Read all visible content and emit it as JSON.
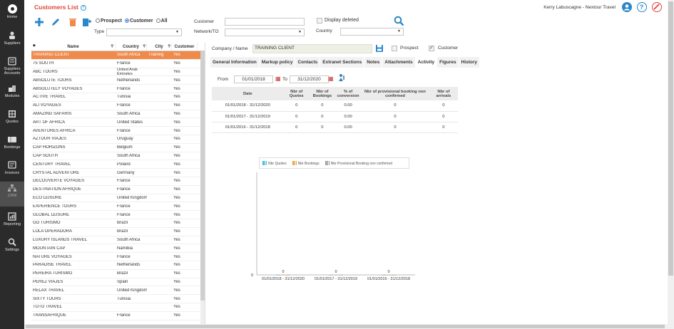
{
  "sidebar": [
    {
      "label": "Home",
      "icon": "home-icon"
    },
    {
      "label": "Suppliers",
      "icon": "suppliers-icon"
    },
    {
      "label": "Suppliers Accounts",
      "icon": "supplier-accounts-icon"
    },
    {
      "label": "Modules",
      "icon": "modules-icon"
    },
    {
      "label": "Quotes",
      "icon": "quotes-icon"
    },
    {
      "label": "Bookings",
      "icon": "bookings-icon"
    },
    {
      "label": "Invoices",
      "icon": "invoices-icon"
    },
    {
      "label": "CRM",
      "icon": "crm-icon"
    },
    {
      "label": "Reporting",
      "icon": "reporting-icon"
    },
    {
      "label": "Settings",
      "icon": "settings-icon"
    }
  ],
  "header": {
    "title": "Customers List",
    "help": "?",
    "user": "Kerry Labuscagne - Nextour Travel"
  },
  "filters": {
    "radio": [
      "Prospect",
      "Customer",
      "All"
    ],
    "type_label": "Type",
    "customer_label": "Customer",
    "network_label": "Network/TO",
    "display_deleted": "Display deleted",
    "country_label": "Country"
  },
  "table": {
    "headers": [
      "Name",
      "Country",
      "City",
      "Customer"
    ],
    "rows": [
      [
        "TRAINING CLIENT",
        "South Africa",
        "Training",
        "Yes"
      ],
      [
        "75 SOUTH",
        "France",
        "",
        "Yes"
      ],
      [
        "ABC TOURS",
        "United Arab Emirates",
        "",
        "Yes"
      ],
      [
        "ABSOLUTE TOURS",
        "Netherlands",
        "",
        "Yes"
      ],
      [
        "ABSOLUTELY VOYAGES",
        "France",
        "",
        "Yes"
      ],
      [
        "ACTIVE TRAVEL",
        "Tunisia",
        "",
        "Yes"
      ],
      [
        "ALI VOYAGES",
        "France",
        "",
        "Yes"
      ],
      [
        "AMAZING SAFARIS",
        "South Africa",
        "",
        "Yes"
      ],
      [
        "ART OF AFRICA",
        "United States",
        "",
        "Yes"
      ],
      [
        "AVENTURES AFRICA",
        "France",
        "",
        "Yes"
      ],
      [
        "AZTOUR VIAJES",
        "Uruguay",
        "",
        "Yes"
      ],
      [
        "CAP HORIZONS",
        "Belgium",
        "",
        "Yes"
      ],
      [
        "CAP SOUTH",
        "South Africa",
        "",
        "Yes"
      ],
      [
        "CENTURY TRAVEL",
        "Poland",
        "",
        "Yes"
      ],
      [
        "CRYSTAL ADVENTURE",
        "Germany",
        "",
        "Yes"
      ],
      [
        "DECOUVERTE VOYAGES",
        "France",
        "",
        "Yes"
      ],
      [
        "DESTINATION AFRIQUE",
        "France",
        "",
        "Yes"
      ],
      [
        "ECO LEISURE",
        "United Kingdom",
        "",
        "Yes"
      ],
      [
        "EXPERIENCE TOURS",
        "France",
        "",
        "Yes"
      ],
      [
        "GLOBAL LEISURE",
        "France",
        "",
        "Yes"
      ],
      [
        "GO TURISMO",
        "Brazil",
        "",
        "Yes"
      ],
      [
        "LOLA OPERADORA",
        "Brazil",
        "",
        "Yes"
      ],
      [
        "LUXURY ISLANDS TRAVEL",
        "South Africa",
        "",
        "Yes"
      ],
      [
        "MOUNTAIN CAP",
        "Namibia",
        "",
        "Yes"
      ],
      [
        "NATURE VOYAGES",
        "France",
        "",
        "Yes"
      ],
      [
        "PARADISE TRAVEL",
        "Netherlands",
        "",
        "Yes"
      ],
      [
        "PEREIRA TURISMO",
        "Brazil",
        "",
        "Yes"
      ],
      [
        "PEREZ VIAJES",
        "Spain",
        "",
        "Yes"
      ],
      [
        "RELAX TRAVEL",
        "United Kingdom",
        "",
        "Yes"
      ],
      [
        "SIXTY TOURS",
        "Tunisia",
        "",
        "Yes"
      ],
      [
        "TOTO TRAVEL",
        "",
        "",
        "Yes"
      ],
      [
        "TRANSAFRIQUE",
        "France",
        "",
        "Yes"
      ]
    ]
  },
  "detail": {
    "company_label": "Company / Name",
    "company_value": "TRAINING CLIENT",
    "prospect_label": "Prospect",
    "customer_label": "Customer",
    "tabs": [
      "General Information",
      "Markup policy",
      "Contacts",
      "Extranet Sections",
      "Notes",
      "Attachments",
      "Activity",
      "Figures",
      "History"
    ],
    "active_tab": "Activity",
    "from_label": "From",
    "from_value": "01/01/2018",
    "to_label": "To",
    "to_value": "31/12/2020"
  },
  "stats": {
    "headers": [
      "Date",
      "Nbr of Quotes",
      "Nbr of Bookings",
      "% of conversion",
      "Nbr of provisional booking non confirmed",
      "Nbr of arrivals"
    ],
    "rows": [
      [
        "01/01/2018 - 31/12/2020",
        "0",
        "0",
        "0.00",
        "0",
        "0"
      ],
      [
        "01/01/2017 - 31/12/2019",
        "0",
        "0",
        "0.00",
        "0",
        "0"
      ],
      [
        "01/01/2016 - 31/12/2018",
        "0",
        "0",
        "0.00",
        "0",
        "0"
      ]
    ]
  },
  "chart_data": {
    "type": "bar",
    "categories": [
      "01/01/2018 - 31/12/2020",
      "01/01/2017 - 31/12/2019",
      "01/01/2016 - 31/12/2018"
    ],
    "series": [
      {
        "name": "Nbr Quotes",
        "values": [
          0,
          0,
          0
        ],
        "color": "#3fb8e0"
      },
      {
        "name": "Nbr Bookings",
        "values": [
          0,
          0,
          0
        ],
        "color": "#f0a040"
      },
      {
        "name": "Nbr Provisional Booking non confirmed",
        "values": [
          0,
          0,
          0
        ],
        "color": "#9a9a9a"
      }
    ],
    "y_tick": "0",
    "data_labels": [
      "0",
      "0",
      "0"
    ]
  },
  "colors": {
    "accent": "#e0473a",
    "selected_row": "#f08a4b",
    "icon_blue": "#2a87c8",
    "sidebar": "#2b2b2b"
  }
}
